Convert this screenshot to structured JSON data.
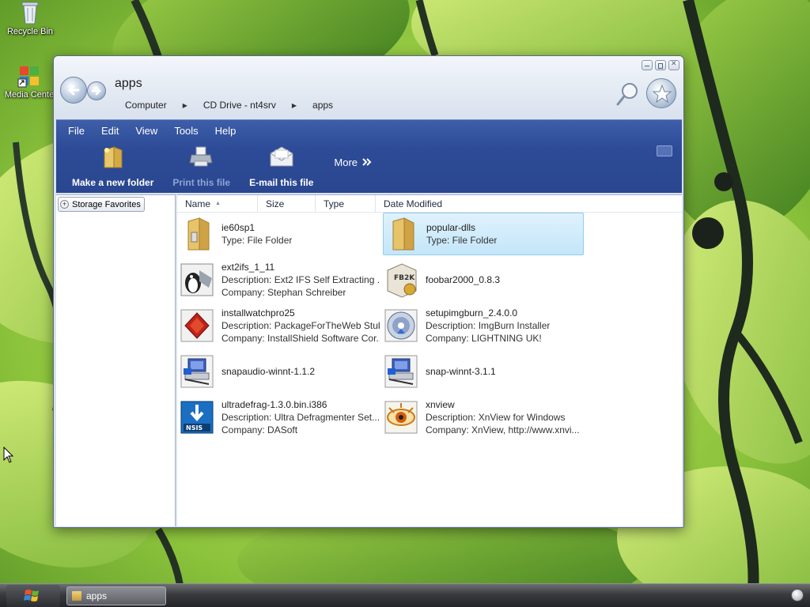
{
  "desktop": {
    "icons": [
      {
        "label": "Recycle Bin",
        "icon": "recycle-bin-icon"
      },
      {
        "label": "Media Cente",
        "icon": "media-center-icon"
      }
    ]
  },
  "window": {
    "title": "apps",
    "breadcrumb": [
      "Computer",
      "CD Drive - nt4srv",
      "apps"
    ],
    "menu": [
      "File",
      "Edit",
      "View",
      "Tools",
      "Help"
    ],
    "commands": [
      {
        "label": "Make a new folder",
        "icon": "new-folder-icon",
        "enabled": true
      },
      {
        "label": "Print this file",
        "icon": "printer-icon",
        "enabled": false
      },
      {
        "label": "E-mail this file",
        "icon": "email-icon",
        "enabled": true
      }
    ],
    "more_label": "More",
    "favorites_tab": {
      "label": "Storage Favorites"
    },
    "columns": [
      "Name",
      "Size",
      "Type",
      "Date Modified"
    ],
    "files": [
      {
        "name": "ie60sp1",
        "lines": [
          "Type: File Folder"
        ],
        "icon": "folder-icon",
        "selected": false
      },
      {
        "name": "popular-dlls",
        "lines": [
          "Type: File Folder"
        ],
        "icon": "folder-icon",
        "selected": true
      },
      {
        "name": "ext2ifs_1_11",
        "lines": [
          "Description: Ext2 IFS Self Extracting ...",
          "Company: Stephan Schreiber"
        ],
        "icon": "installer-penguin-icon",
        "selected": false
      },
      {
        "name": "foobar2000_0.8.3",
        "lines": [],
        "icon": "foobar-box-icon",
        "selected": false
      },
      {
        "name": "installwatchpro25",
        "lines": [
          "Description: PackageForTheWeb Stub",
          "Company: InstallShield Software Cor..."
        ],
        "icon": "installshield-icon",
        "selected": false
      },
      {
        "name": "setupimgburn_2.4.0.0",
        "lines": [
          "Description: ImgBurn Installer",
          "Company: LIGHTNING UK!"
        ],
        "icon": "imgburn-disc-icon",
        "selected": false
      },
      {
        "name": "snapaudio-winnt-1.1.2",
        "lines": [],
        "icon": "setup-computer-icon",
        "selected": false
      },
      {
        "name": "snap-winnt-3.1.1",
        "lines": [],
        "icon": "setup-computer-icon",
        "selected": false
      },
      {
        "name": "ultradefrag-1.3.0.bin.i386",
        "lines": [
          "Description: Ultra Defragmenter Set...",
          "Company: DASoft"
        ],
        "icon": "nsis-installer-icon",
        "selected": false
      },
      {
        "name": "xnview",
        "lines": [
          "Description: XnView for Windows",
          "Company: XnView, http://www.xnvi..."
        ],
        "icon": "xnview-eye-icon",
        "selected": false
      }
    ]
  },
  "taskbar": {
    "task_label": "apps"
  }
}
